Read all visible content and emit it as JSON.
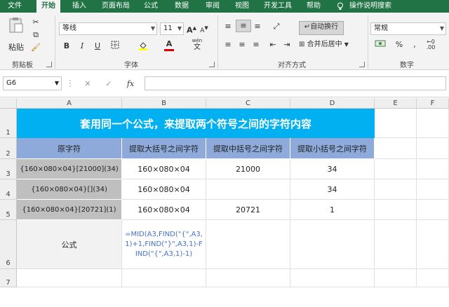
{
  "ribbon": {
    "tabs": [
      "文件",
      "开始",
      "插入",
      "页面布局",
      "公式",
      "数据",
      "审阅",
      "视图",
      "开发工具",
      "帮助"
    ],
    "active_tab": "开始",
    "search_label": "操作说明搜索",
    "clipboard": {
      "paste_label": "粘贴",
      "group_label": "剪贴板"
    },
    "font": {
      "name": "等线",
      "size": "11",
      "group_label": "字体",
      "bold": "B",
      "italic": "I",
      "underline": "U",
      "grow": "A",
      "shrink": "A",
      "color_a": "A",
      "wen": "wén"
    },
    "alignment": {
      "wrap_label": "自动换行",
      "merge_label": "合并后居中",
      "group_label": "对齐方式"
    },
    "number": {
      "format": "常规",
      "group_label": "数字",
      "percent": "%"
    }
  },
  "formula_bar": {
    "name_box": "G6",
    "fx": "fx",
    "formula": ""
  },
  "grid": {
    "columns": [
      "A",
      "B",
      "C",
      "D",
      "E",
      "F"
    ],
    "rows": [
      "1",
      "2",
      "3",
      "4",
      "5",
      "6",
      "7"
    ],
    "title": "套用同一个公式，来提取两个符号之间的字符内容",
    "headers": [
      "原字符",
      "提取大括号之间字符",
      "提取中括号之间字符",
      "提取小括号之间字符"
    ],
    "data": [
      [
        "{160×080×04}[21000](34)",
        "160×080×04",
        "21000",
        "34"
      ],
      [
        "{160×080×04}[](34)",
        "160×080×04",
        "",
        "34"
      ],
      [
        "{160×080×04}[20721](1)",
        "160×080×04",
        "20721",
        "1"
      ]
    ],
    "formula_label": "公式",
    "formula_text": "=MID(A3,FIND(\"{\",A3,1)+1,FIND(\"}\",A3,1)-FIND(\"{\",A3,1)-1)",
    "colors": {
      "title_bg": "#00b0f0",
      "header_bg": "#8eaadb",
      "source_bg": "#bfbfbf",
      "formula_color": "#4472c4",
      "ribbon_green": "#217346"
    }
  }
}
